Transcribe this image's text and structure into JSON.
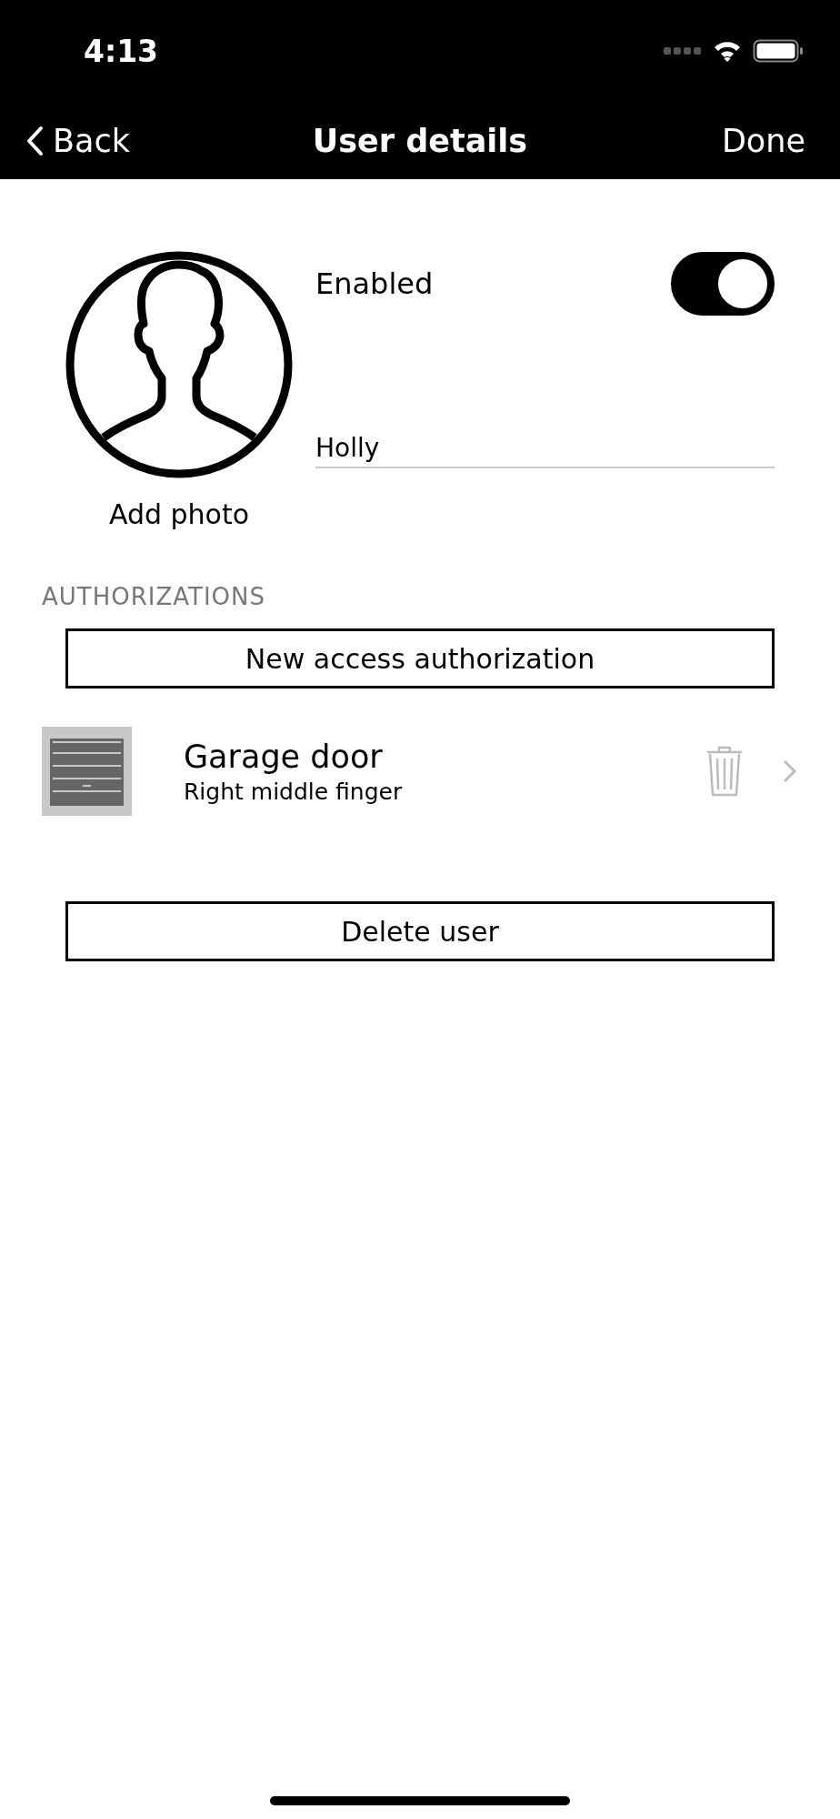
{
  "status_bar": {
    "time": "4:13"
  },
  "nav": {
    "back": "Back",
    "title": "User details",
    "done": "Done"
  },
  "profile": {
    "add_photo": "Add photo",
    "enabled_label": "Enabled",
    "enabled": true,
    "name": "Holly"
  },
  "authorizations": {
    "header": "AUTHORIZATIONS",
    "new_button": "New access authorization",
    "items": [
      {
        "title": "Garage door",
        "subtitle": "Right middle finger"
      }
    ]
  },
  "delete_button": "Delete user"
}
